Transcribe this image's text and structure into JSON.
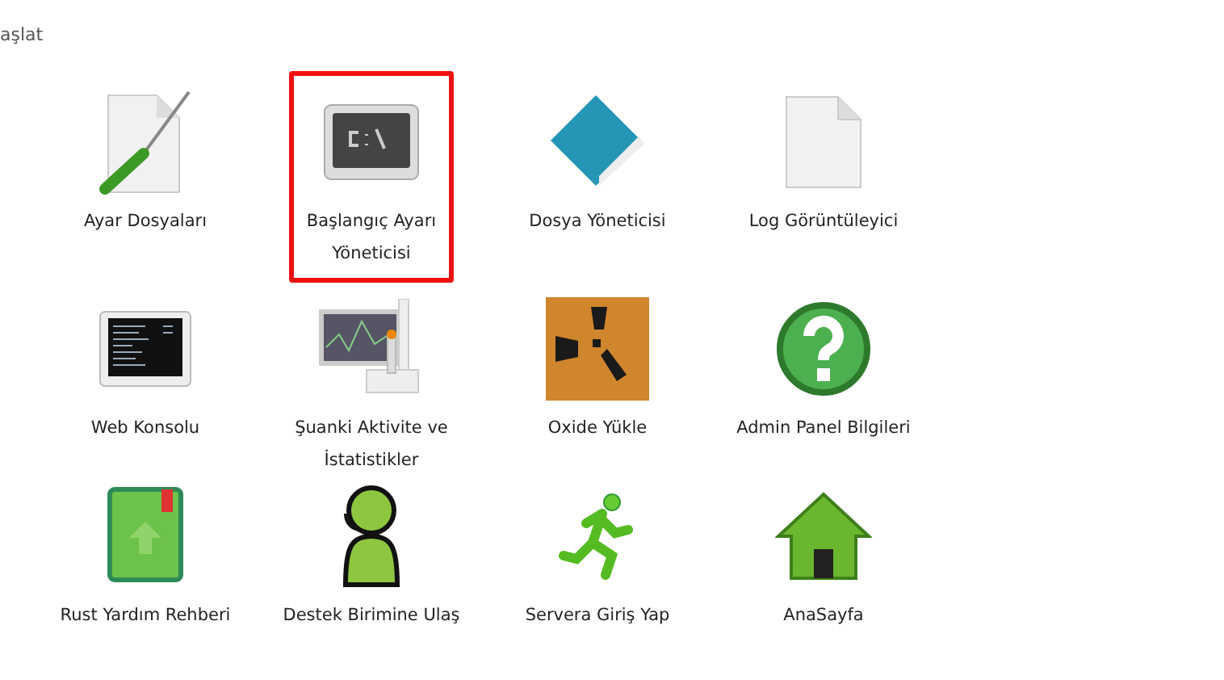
{
  "header_link": "aşlat",
  "items": [
    {
      "label": "Ayar Dosyaları",
      "kind": "config",
      "selected": false
    },
    {
      "label": "Başlangıç Ayarı Yöneticisi",
      "kind": "terminal",
      "selected": true
    },
    {
      "label": "Dosya Yöneticisi",
      "kind": "folder",
      "selected": false
    },
    {
      "label": "Log Görüntüleyici",
      "kind": "file",
      "selected": false
    },
    {
      "label": "Web Konsolu",
      "kind": "console",
      "selected": false
    },
    {
      "label": "Şuanki Aktivite ve İstatistikler",
      "kind": "monitor",
      "selected": false
    },
    {
      "label": "Oxide Yükle",
      "kind": "rust",
      "selected": false
    },
    {
      "label": "Admin Panel Bilgileri",
      "kind": "help",
      "selected": false
    },
    {
      "label": "Rust Yardım Rehberi",
      "kind": "book",
      "selected": false
    },
    {
      "label": "Destek Birimine Ulaş",
      "kind": "support",
      "selected": false
    },
    {
      "label": "Servera Giriş Yap",
      "kind": "run",
      "selected": false
    },
    {
      "label": "AnaSayfa",
      "kind": "home",
      "selected": false
    }
  ]
}
